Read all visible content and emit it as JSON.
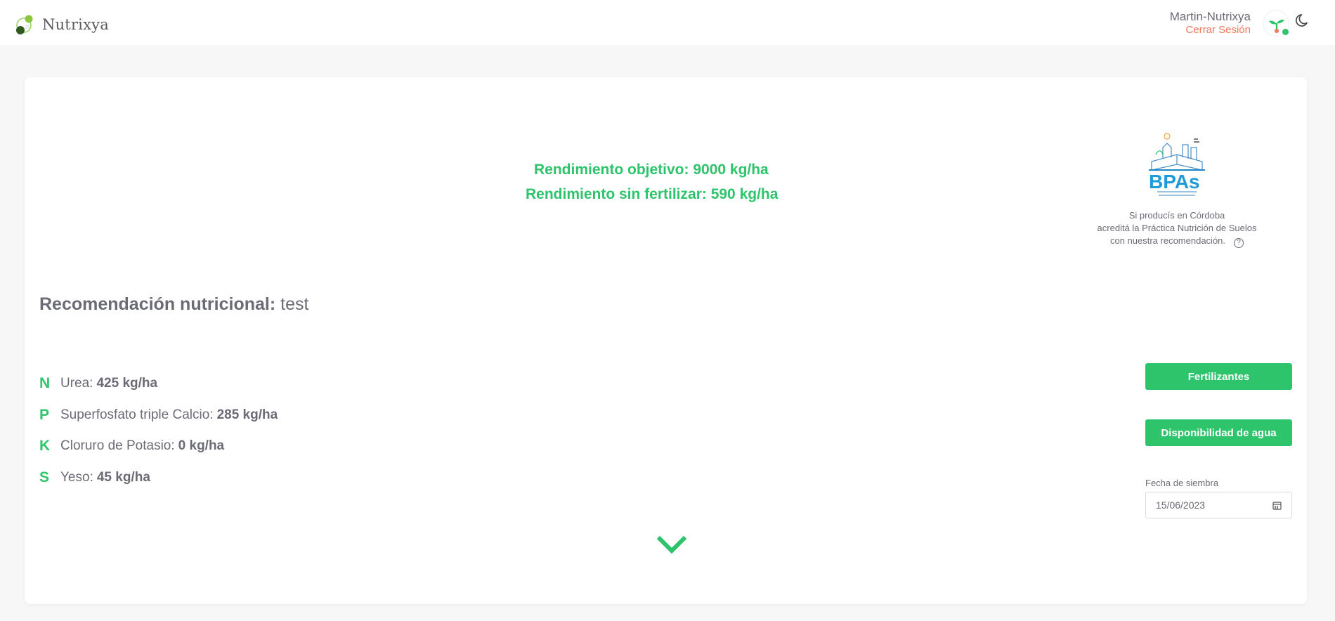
{
  "header": {
    "brand_name": "Nutrixya",
    "user_name": "Martin-Nutrixya",
    "logout_label": "Cerrar Sesión"
  },
  "yield": {
    "objective": "Rendimiento objetivo: 9000 kg/ha",
    "unfertilized": "Rendimiento sin fertilizar: 590 kg/ha"
  },
  "bpas": {
    "logo_text": "BPAs",
    "caption_line1": "Si producís en Córdoba",
    "caption_line2": "acreditá la Práctica Nutrición de Suelos",
    "caption_line3": "con nuestra recomendación.",
    "help_glyph": "?"
  },
  "recommendation": {
    "title_bold": "Recomendación nutricional:",
    "title_name": "test",
    "items": [
      {
        "letter": "N",
        "label": "Urea:",
        "value": "425 kg/ha"
      },
      {
        "letter": "P",
        "label": "Superfosfato triple Calcio:",
        "value": "285 kg/ha"
      },
      {
        "letter": "K",
        "label": "Cloruro de Potasio:",
        "value": "0 kg/ha"
      },
      {
        "letter": "S",
        "label": "Yeso:",
        "value": "45 kg/ha"
      }
    ]
  },
  "actions": {
    "fertilizers_label": "Fertilizantes",
    "water_label": "Disponibilidad de agua"
  },
  "sowing": {
    "label": "Fecha de siembra",
    "value": "15/06/2023"
  },
  "colors": {
    "accent_green": "#2ec46b",
    "logout_orange": "#f4775b",
    "text_gray": "#6b6b76",
    "background": "#f7f7f7"
  },
  "icons": [
    "brand-logo-icon",
    "avatar-sprout-icon",
    "moon-icon",
    "help-circle-icon",
    "calendar-icon",
    "chevron-down-icon"
  ]
}
